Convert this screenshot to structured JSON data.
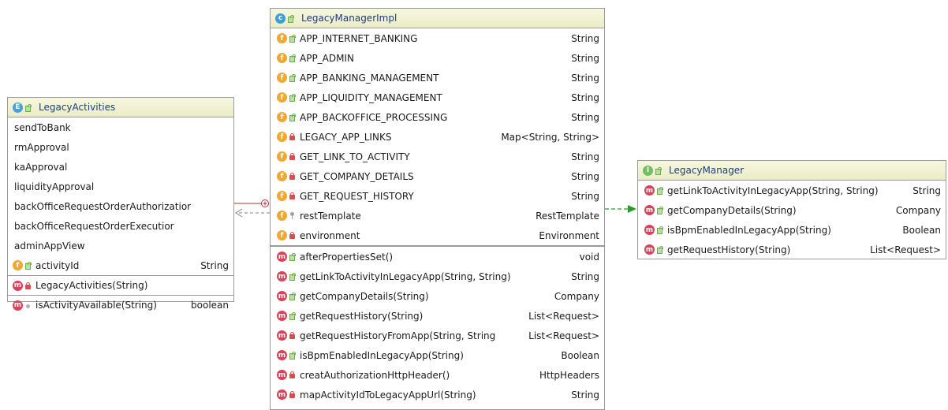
{
  "legacy_activities": {
    "icon": "E",
    "title": "LegacyActivities",
    "constants": [
      "sendToBank",
      "rmApproval",
      "kaApproval",
      "liquidityApproval",
      "backOfficeRequestOrderAuthorizatior",
      "backOfficeRequestOrderExecutior",
      "adminAppView"
    ],
    "field": {
      "icon": "f",
      "name": "activityId",
      "type": "String"
    },
    "methods": [
      {
        "icon": "m",
        "name": "LegacyActivities(String)",
        "type": ""
      },
      {
        "icon": "m",
        "name": "isActivityAvailable(String)",
        "type": "boolean"
      }
    ]
  },
  "legacy_manager_impl": {
    "icon": "c",
    "title": "LegacyManagerImpl",
    "fields": [
      {
        "icon": "f",
        "name": "APP_INTERNET_BANKING",
        "type": "String"
      },
      {
        "icon": "f",
        "name": "APP_ADMIN",
        "type": "String"
      },
      {
        "icon": "f",
        "name": "APP_BANKING_MANAGEMENT",
        "type": "String"
      },
      {
        "icon": "f",
        "name": "APP_LIQUIDITY_MANAGEMENT",
        "type": "String"
      },
      {
        "icon": "f",
        "name": "APP_BACKOFFICE_PROCESSING",
        "type": "String"
      },
      {
        "icon": "f",
        "name": "LEGACY_APP_LINKS",
        "type": "Map<String, String>"
      },
      {
        "icon": "f",
        "name": "GET_LINK_TO_ACTIVITY",
        "type": "String"
      },
      {
        "icon": "f",
        "name": "GET_COMPANY_DETAILS",
        "type": "String"
      },
      {
        "icon": "f",
        "name": "GET_REQUEST_HISTORY",
        "type": "String"
      },
      {
        "icon": "f",
        "name": "restTemplate",
        "type": "RestTemplate"
      },
      {
        "icon": "f",
        "name": "environment",
        "type": "Environment"
      }
    ],
    "methods": [
      {
        "icon": "m",
        "name": "afterPropertiesSet()",
        "type": "void"
      },
      {
        "icon": "m",
        "name": "getLinkToActivityInLegacyApp(String, String)",
        "type": "String"
      },
      {
        "icon": "m",
        "name": "getCompanyDetails(String)",
        "type": "Company"
      },
      {
        "icon": "m",
        "name": "getRequestHistory(String)",
        "type": "List<Request>"
      },
      {
        "icon": "m",
        "name": "getRequestHistoryFromApp(String, String",
        "type": "List<Request>"
      },
      {
        "icon": "m",
        "name": "isBpmEnabledInLegacyApp(String)",
        "type": "Boolean"
      },
      {
        "icon": "m",
        "name": "creatAuthorizationHttpHeader()",
        "type": "HttpHeaders"
      },
      {
        "icon": "m",
        "name": "mapActivityIdToLegacyAppUrl(String)",
        "type": "String"
      }
    ]
  },
  "legacy_manager": {
    "icon": "I",
    "title": "LegacyManager",
    "methods": [
      {
        "icon": "m",
        "name": "getLinkToActivityInLegacyApp(String, String)",
        "type": "String"
      },
      {
        "icon": "m",
        "name": "getCompanyDetails(String)",
        "type": "Company"
      },
      {
        "icon": "m",
        "name": "isBpmEnabledInLegacyApp(String)",
        "type": "Boolean"
      },
      {
        "icon": "m",
        "name": "getRequestHistory(String)",
        "type": "List<Request>"
      }
    ]
  },
  "colors": {
    "header": "#ececc8",
    "border": "#9a9a9a",
    "inner_class_line": "#b03030",
    "dependency_line": "#808080",
    "implements_line": "#2a9a2a"
  }
}
